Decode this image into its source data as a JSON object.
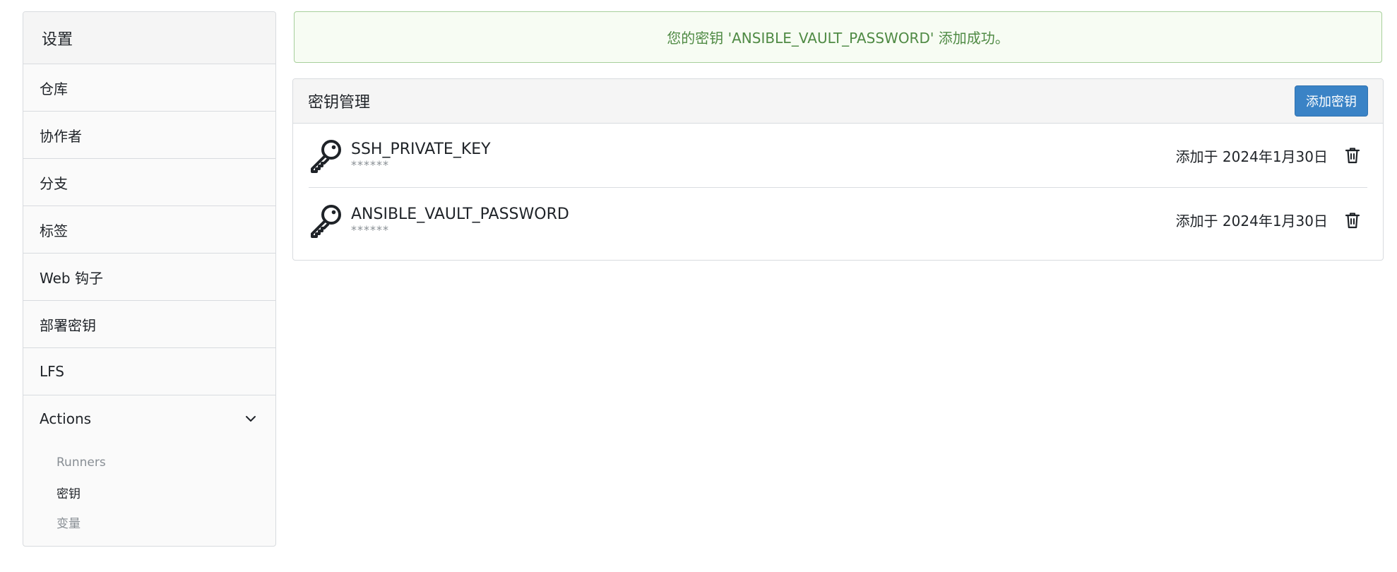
{
  "sidebar": {
    "title": "设置",
    "items": [
      {
        "label": "仓库"
      },
      {
        "label": "协作者"
      },
      {
        "label": "分支"
      },
      {
        "label": "标签"
      },
      {
        "label": "Web 钩子"
      },
      {
        "label": "部署密钥"
      },
      {
        "label": "LFS"
      }
    ],
    "actions_group": {
      "label": "Actions",
      "expanded": true,
      "icon": "chevron-down-icon",
      "sub_items": [
        {
          "label": "Runners",
          "active": false
        },
        {
          "label": "密钥",
          "active": true
        },
        {
          "label": "变量",
          "active": false
        }
      ]
    }
  },
  "flash": {
    "message": "您的密钥 'ANSIBLE_VAULT_PASSWORD' 添加成功。"
  },
  "secrets_panel": {
    "title": "密钥管理",
    "add_button": "添加密钥",
    "secrets": [
      {
        "name": "SSH_PRIVATE_KEY",
        "mask": "******",
        "added": "添加于 2024年1月30日",
        "icon": "key-icon",
        "action_icon": "trash-icon"
      },
      {
        "name": "ANSIBLE_VAULT_PASSWORD",
        "mask": "******",
        "added": "添加于 2024年1月30日",
        "icon": "key-icon",
        "action_icon": "trash-icon"
      }
    ]
  },
  "colors": {
    "primary": "#3a83c6",
    "success_text": "#4f8a44",
    "success_bg": "#f7fcf3",
    "success_border": "#a7cf9b",
    "muted_text": "#888e94",
    "border": "#d8dbdf"
  }
}
